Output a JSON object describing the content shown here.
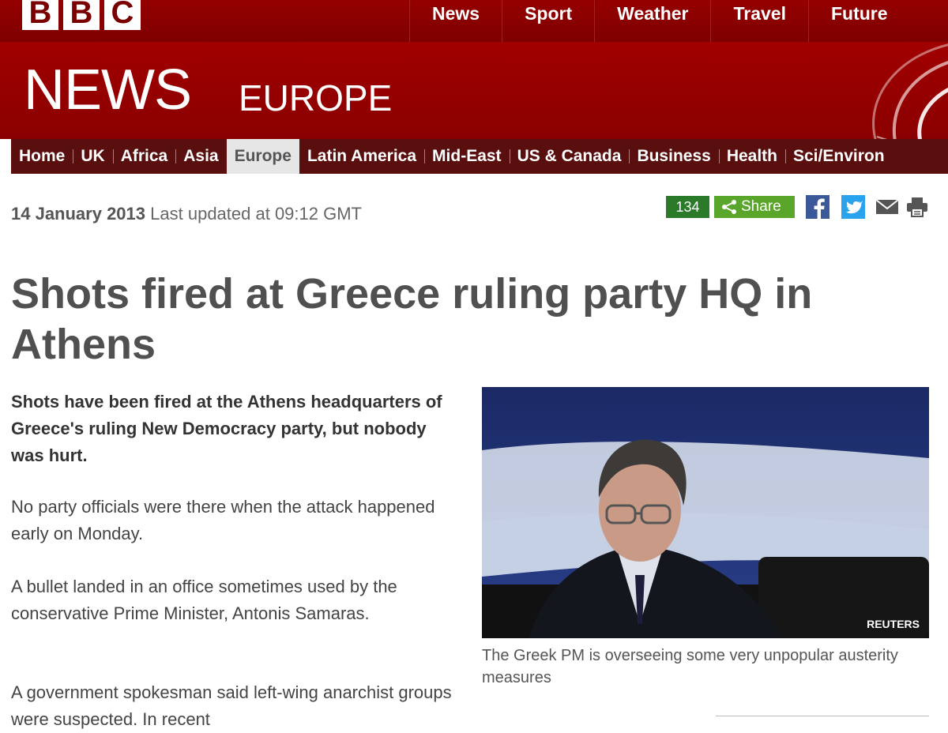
{
  "logo": {
    "letters": [
      "B",
      "B",
      "C"
    ]
  },
  "top_nav": [
    "News",
    "Sport",
    "Weather",
    "Travel",
    "Future"
  ],
  "masthead": {
    "title": "NEWS",
    "section": "EUROPE"
  },
  "section_nav": [
    "Home",
    "UK",
    "Africa",
    "Asia",
    "Europe",
    "Latin America",
    "Mid-East",
    "US & Canada",
    "Business",
    "Health",
    "Sci/Environ"
  ],
  "active_section": "Europe",
  "dateline": {
    "date": "14 January 2013",
    "updated": "Last updated at 09:12 GMT"
  },
  "share": {
    "count": "134",
    "label": "Share"
  },
  "icons": [
    "share-icon",
    "facebook-icon",
    "twitter-icon",
    "email-icon",
    "print-icon"
  ],
  "colors": {
    "brand_red": "#990000",
    "nav_dark": "#5a0f0f",
    "share_green": "#5aa62a"
  },
  "article": {
    "headline": "Shots fired at Greece ruling party HQ in Athens",
    "intro": "Shots have been fired at the Athens headquarters of Greece's ruling New Democracy party, but nobody was hurt.",
    "paragraphs": [
      "No party officials were there when the attack happened early on Monday.",
      "A bullet landed in an office sometimes used by the conservative Prime Minister, Antonis Samaras.",
      "A government spokesman said left-wing anarchist groups were suspected. In recent"
    ]
  },
  "image": {
    "credit": "REUTERS",
    "caption": "The Greek PM is overseeing some very unpopular austerity measures"
  }
}
